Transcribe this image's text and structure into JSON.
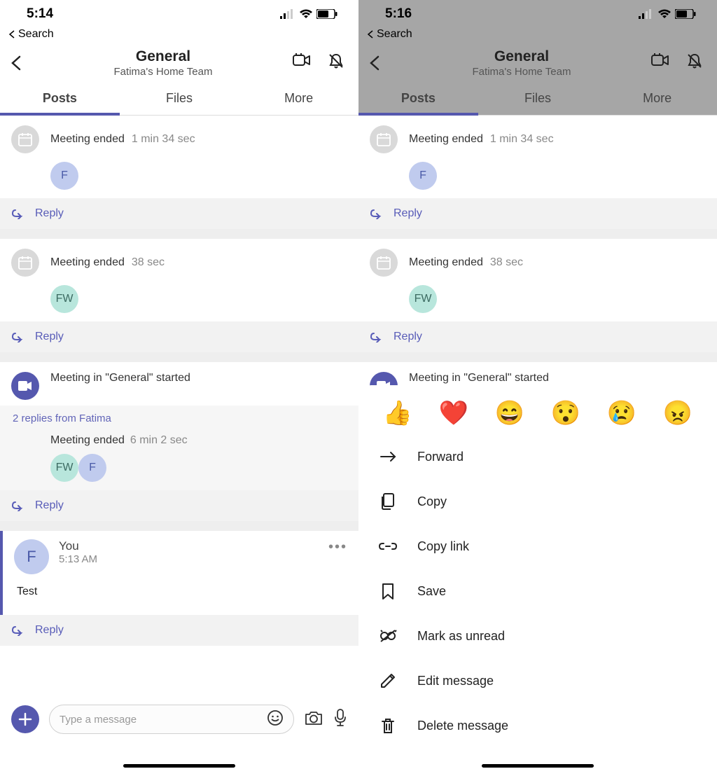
{
  "left": {
    "status": {
      "time": "5:14"
    },
    "search_back": "Search",
    "header": {
      "title": "General",
      "subtitle": "Fatima's Home Team"
    },
    "tabs": {
      "posts": "Posts",
      "files": "Files",
      "more": "More"
    },
    "posts": [
      {
        "title": "Meeting ended",
        "duration": "1 min 34 sec",
        "avatars": [
          {
            "label": "F",
            "class": "f"
          }
        ]
      },
      {
        "title": "Meeting ended",
        "duration": "38 sec",
        "avatars": [
          {
            "label": "FW",
            "class": "fw"
          }
        ]
      }
    ],
    "meeting_started": "Meeting in \"General\"  started",
    "replies_note": "2 replies from Fatima",
    "nested": {
      "title": "Meeting ended",
      "duration": "6 min 2 sec",
      "avatars": [
        {
          "label": "FW",
          "class": "fw"
        },
        {
          "label": "F",
          "class": "f"
        }
      ]
    },
    "you_post": {
      "name": "You",
      "time": "5:13 AM",
      "body": "Test"
    },
    "reply_label": "Reply",
    "composer": {
      "placeholder": "Type a message"
    }
  },
  "right": {
    "status": {
      "time": "5:16"
    },
    "actions": {
      "forward": "Forward",
      "copy": "Copy",
      "copy_link": "Copy link",
      "save": "Save",
      "mark_unread": "Mark as unread",
      "edit": "Edit message",
      "delete": "Delete message"
    }
  }
}
